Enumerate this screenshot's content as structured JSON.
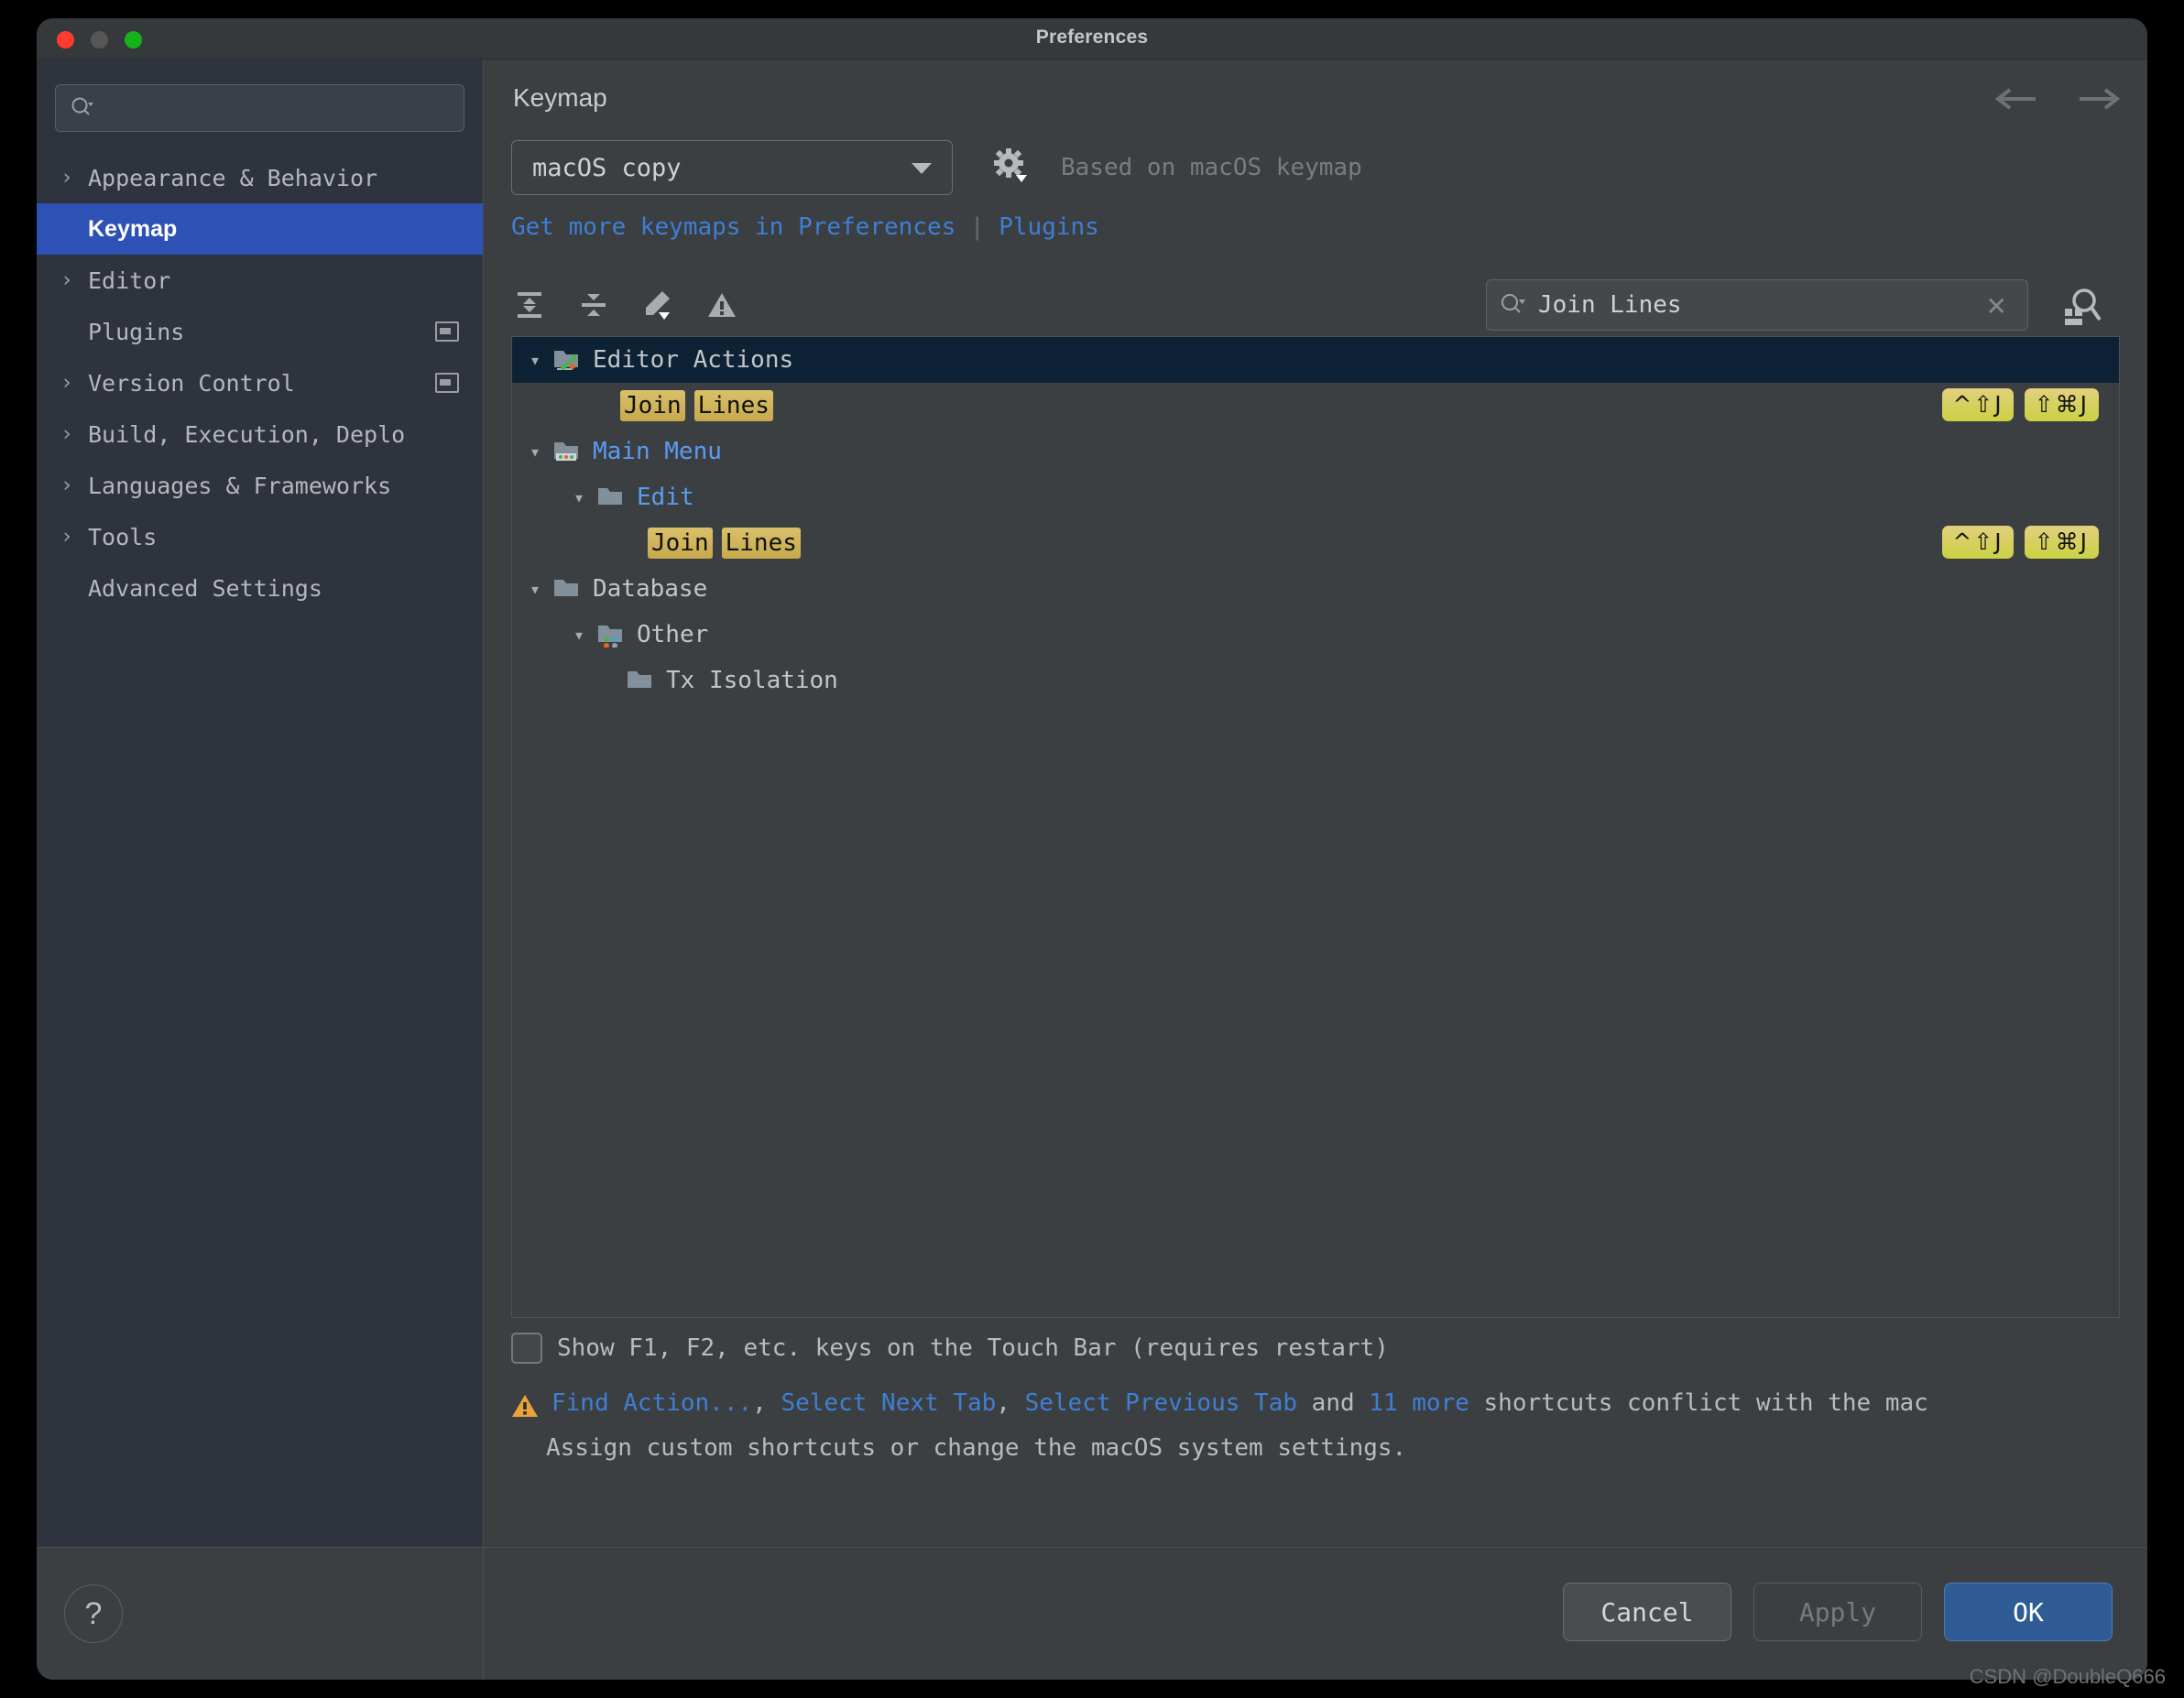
{
  "window": {
    "title": "Preferences",
    "traffic_lights": [
      "close",
      "minimize",
      "zoom"
    ]
  },
  "sidebar": {
    "search_placeholder": "",
    "items": [
      {
        "label": "Appearance & Behavior",
        "expandable": true,
        "selected": false,
        "badge": false
      },
      {
        "label": "Keymap",
        "expandable": false,
        "selected": true,
        "badge": false
      },
      {
        "label": "Editor",
        "expandable": true,
        "selected": false,
        "badge": false
      },
      {
        "label": "Plugins",
        "expandable": false,
        "selected": false,
        "badge": true
      },
      {
        "label": "Version Control",
        "expandable": true,
        "selected": false,
        "badge": true
      },
      {
        "label": "Build, Execution, Deplo",
        "expandable": true,
        "selected": false,
        "badge": false
      },
      {
        "label": "Languages & Frameworks",
        "expandable": true,
        "selected": false,
        "badge": false
      },
      {
        "label": "Tools",
        "expandable": true,
        "selected": false,
        "badge": false
      },
      {
        "label": "Advanced Settings",
        "expandable": false,
        "selected": false,
        "badge": false
      }
    ],
    "help_label": "?"
  },
  "page": {
    "title": "Keymap",
    "keymap_selected": "macOS copy",
    "based_on": "Based on macOS keymap",
    "get_more_prefix": "Get more keymaps in Preferences",
    "get_more_sep": "|",
    "get_more_link": "Plugins"
  },
  "toolbar": {
    "icons": [
      "expand-all-icon",
      "collapse-all-icon",
      "edit-shortcut-icon",
      "show-conflicts-icon"
    ],
    "find_value": "Join Lines",
    "find_placeholder": "",
    "clear_label": "✕",
    "keyboard_search_icon": "find-by-shortcut-icon"
  },
  "tree": {
    "rows": [
      {
        "indent": 0,
        "chevron": "⌄",
        "icon": "editor-actions-folder-icon",
        "label": "Editor Actions",
        "label_color": "gray",
        "selected": true,
        "highlight": null,
        "shortcuts": []
      },
      {
        "indent": 2,
        "chevron": "",
        "icon": null,
        "label": "",
        "label_color": "gray",
        "selected": false,
        "highlight": [
          "Join",
          "Lines"
        ],
        "shortcuts": [
          "^⇧J",
          "⇧⌘J"
        ]
      },
      {
        "indent": 0,
        "chevron": "⌄",
        "icon": "main-menu-folder-icon",
        "label": "Main Menu",
        "label_color": "blue",
        "selected": false,
        "highlight": null,
        "shortcuts": []
      },
      {
        "indent": 1,
        "chevron": "⌄",
        "icon": "folder-icon",
        "label": "Edit",
        "label_color": "blue",
        "selected": false,
        "highlight": null,
        "shortcuts": []
      },
      {
        "indent": 2,
        "chevron": "",
        "icon": null,
        "label": "",
        "label_color": "gray",
        "selected": false,
        "highlight": [
          "Join",
          "Lines"
        ],
        "shortcuts": [
          "^⇧J",
          "⇧⌘J"
        ]
      },
      {
        "indent": 0,
        "chevron": "⌄",
        "icon": "folder-icon",
        "label": "Database",
        "label_color": "gray",
        "selected": false,
        "highlight": null,
        "shortcuts": []
      },
      {
        "indent": 1,
        "chevron": "⌄",
        "icon": "other-folder-icon",
        "label": "Other",
        "label_color": "gray",
        "selected": false,
        "highlight": null,
        "shortcuts": []
      },
      {
        "indent": 2,
        "chevron": "",
        "icon": "folder-icon",
        "label": "Tx Isolation",
        "label_color": "gray",
        "selected": false,
        "highlight": null,
        "shortcuts": []
      }
    ]
  },
  "options": {
    "touchbar_checkbox_label": "Show F1, F2, etc. keys on the Touch Bar (requires restart)",
    "touchbar_checked": false
  },
  "conflict": {
    "link1": "Find Action...",
    "comma1": ", ",
    "link2": "Select Next Tab",
    "comma2": ", ",
    "link3": "Select Previous Tab",
    "and": " and ",
    "link4": "11 more",
    "tail": " shortcuts conflict with the mac",
    "line2": "Assign custom shortcuts or change the macOS system settings."
  },
  "footer": {
    "cancel_label": "Cancel",
    "apply_label": "Apply",
    "ok_label": "OK"
  },
  "watermark": "CSDN @DoubleQ666",
  "colors": {
    "accent_blue": "#2d51b5",
    "link_blue": "#3e7fd4",
    "selected_row": "#0d2335",
    "highlight_gold": "#c7a94c",
    "ok_button": "#2f5c94",
    "warning_orange": "#e8a33d"
  }
}
